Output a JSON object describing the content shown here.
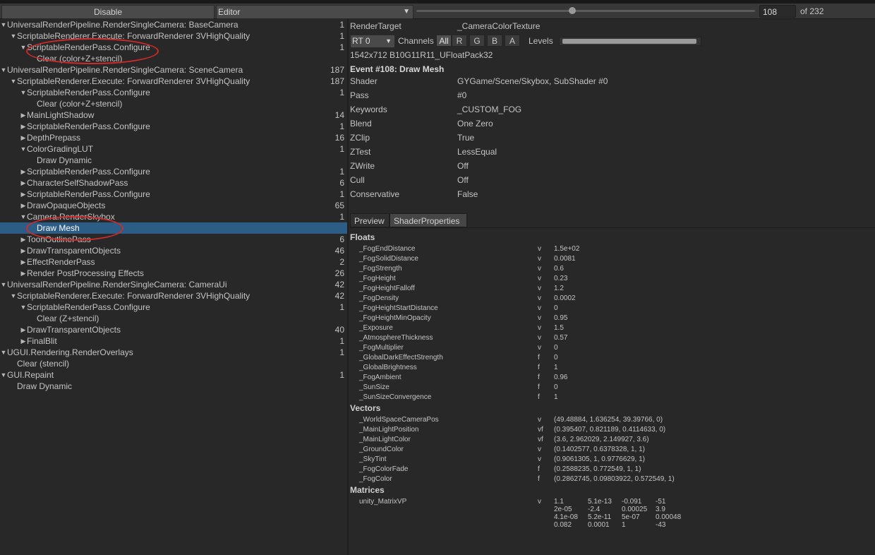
{
  "toolbar": {
    "disable_label": "Disable",
    "mode_value": "Editor",
    "event_number": "108",
    "event_total": "of 232",
    "slider_position": 0.46
  },
  "tree": [
    {
      "label": "UniversalRenderPipeline.RenderSingleCamera: BaseCamera",
      "count": "1",
      "depth": 0,
      "expander": "open"
    },
    {
      "label": "ScriptableRenderer.Execute: ForwardRenderer 3VHighQuality",
      "count": "1",
      "depth": 1,
      "expander": "open"
    },
    {
      "label": "ScriptableRenderPass.Configure",
      "count": "1",
      "depth": 2,
      "expander": "open"
    },
    {
      "label": "Clear (color+Z+stencil)",
      "count": "",
      "depth": 3,
      "expander": "none"
    },
    {
      "label": "UniversalRenderPipeline.RenderSingleCamera: SceneCamera",
      "count": "187",
      "depth": 0,
      "expander": "open"
    },
    {
      "label": "ScriptableRenderer.Execute: ForwardRenderer 3VHighQuality",
      "count": "187",
      "depth": 1,
      "expander": "open"
    },
    {
      "label": "ScriptableRenderPass.Configure",
      "count": "1",
      "depth": 2,
      "expander": "open"
    },
    {
      "label": "Clear (color+Z+stencil)",
      "count": "",
      "depth": 3,
      "expander": "none"
    },
    {
      "label": "MainLightShadow",
      "count": "14",
      "depth": 2,
      "expander": "closed"
    },
    {
      "label": "ScriptableRenderPass.Configure",
      "count": "1",
      "depth": 2,
      "expander": "closed"
    },
    {
      "label": "DepthPrepass",
      "count": "16",
      "depth": 2,
      "expander": "closed"
    },
    {
      "label": "ColorGradingLUT",
      "count": "1",
      "depth": 2,
      "expander": "open"
    },
    {
      "label": "Draw Dynamic",
      "count": "",
      "depth": 3,
      "expander": "none"
    },
    {
      "label": "ScriptableRenderPass.Configure",
      "count": "1",
      "depth": 2,
      "expander": "closed"
    },
    {
      "label": "CharacterSelfShadowPass",
      "count": "6",
      "depth": 2,
      "expander": "closed"
    },
    {
      "label": "ScriptableRenderPass.Configure",
      "count": "1",
      "depth": 2,
      "expander": "closed"
    },
    {
      "label": "DrawOpaqueObjects",
      "count": "65",
      "depth": 2,
      "expander": "closed"
    },
    {
      "label": "Camera.RenderSkybox",
      "count": "1",
      "depth": 2,
      "expander": "open"
    },
    {
      "label": "Draw Mesh",
      "count": "",
      "depth": 3,
      "expander": "none",
      "selected": true
    },
    {
      "label": "ToonOutlinePass",
      "count": "6",
      "depth": 2,
      "expander": "closed"
    },
    {
      "label": "DrawTransparentObjects",
      "count": "46",
      "depth": 2,
      "expander": "closed"
    },
    {
      "label": "EffectRenderPass",
      "count": "2",
      "depth": 2,
      "expander": "closed"
    },
    {
      "label": "Render PostProcessing Effects",
      "count": "26",
      "depth": 2,
      "expander": "closed"
    },
    {
      "label": "UniversalRenderPipeline.RenderSingleCamera: CameraUi",
      "count": "42",
      "depth": 0,
      "expander": "open"
    },
    {
      "label": "ScriptableRenderer.Execute: ForwardRenderer 3VHighQuality",
      "count": "42",
      "depth": 1,
      "expander": "open"
    },
    {
      "label": "ScriptableRenderPass.Configure",
      "count": "1",
      "depth": 2,
      "expander": "open"
    },
    {
      "label": "Clear (Z+stencil)",
      "count": "",
      "depth": 3,
      "expander": "none"
    },
    {
      "label": "DrawTransparentObjects",
      "count": "40",
      "depth": 2,
      "expander": "closed"
    },
    {
      "label": "FinalBlit",
      "count": "1",
      "depth": 2,
      "expander": "closed"
    },
    {
      "label": "UGUI.Rendering.RenderOverlays",
      "count": "1",
      "depth": 0,
      "expander": "open"
    },
    {
      "label": "Clear (stencil)",
      "count": "",
      "depth": 1,
      "expander": "none"
    },
    {
      "label": "GUI.Repaint",
      "count": "1",
      "depth": 0,
      "expander": "open"
    },
    {
      "label": "Draw Dynamic",
      "count": "",
      "depth": 1,
      "expander": "none"
    }
  ],
  "detail": {
    "render_target_label": "RenderTarget",
    "render_target_value": "_CameraColorTexture",
    "rt_select": "RT 0",
    "channels_label": "Channels",
    "channels": [
      "All",
      "R",
      "G",
      "B",
      "A"
    ],
    "levels_label": "Levels",
    "format": "1542x712 B10G11R11_UFloatPack32",
    "event_title": "Event #108: Draw Mesh",
    "props": [
      {
        "k": "Shader",
        "v": "GYGame/Scene/Skybox, SubShader #0"
      },
      {
        "k": "Pass",
        "v": "#0"
      },
      {
        "k": "Keywords",
        "v": "_CUSTOM_FOG"
      },
      {
        "k": "Blend",
        "v": "One Zero"
      },
      {
        "k": "ZClip",
        "v": "True"
      },
      {
        "k": "ZTest",
        "v": "LessEqual"
      },
      {
        "k": "ZWrite",
        "v": "Off"
      },
      {
        "k": "Cull",
        "v": "Off"
      },
      {
        "k": "Conservative",
        "v": "False"
      }
    ],
    "tabs": [
      "Preview",
      "ShaderProperties"
    ],
    "floats_title": "Floats",
    "floats": [
      {
        "n": "_FogEndDistance",
        "t": "v",
        "v": "1.5e+02"
      },
      {
        "n": "_FogSolidDistance",
        "t": "v",
        "v": "0.0081"
      },
      {
        "n": "_FogStrength",
        "t": "v",
        "v": "0.6"
      },
      {
        "n": "_FogHeight",
        "t": "v",
        "v": "0.23"
      },
      {
        "n": "_FogHeightFalloff",
        "t": "v",
        "v": "1.2"
      },
      {
        "n": "_FogDensity",
        "t": "v",
        "v": "0.0002"
      },
      {
        "n": "_FogHeightStartDistance",
        "t": "v",
        "v": "0"
      },
      {
        "n": "_FogHeightMinOpacity",
        "t": "v",
        "v": "0.95"
      },
      {
        "n": "_Exposure",
        "t": "v",
        "v": "1.5"
      },
      {
        "n": "_AtmosphereThickness",
        "t": "v",
        "v": "0.57"
      },
      {
        "n": "_FogMultiplier",
        "t": "v",
        "v": "0"
      },
      {
        "n": "_GlobalDarkEffectStrength",
        "t": "f",
        "v": "0"
      },
      {
        "n": "_GlobalBrightness",
        "t": "f",
        "v": "1"
      },
      {
        "n": "_FogAmbient",
        "t": "f",
        "v": "0.96"
      },
      {
        "n": "_SunSize",
        "t": "f",
        "v": "0"
      },
      {
        "n": "_SunSizeConvergence",
        "t": "f",
        "v": "1"
      }
    ],
    "vectors_title": "Vectors",
    "vectors": [
      {
        "n": "_WorldSpaceCameraPos",
        "t": "v",
        "v": "(49.48884, 1.636254, 39.39766, 0)"
      },
      {
        "n": "_MainLightPosition",
        "t": "vf",
        "v": "(0.395407, 0.821189, 0.4114633, 0)"
      },
      {
        "n": "_MainLightColor",
        "t": "vf",
        "v": "(3.6, 2.962029, 2.149927, 3.6)"
      },
      {
        "n": "_GroundColor",
        "t": "v",
        "v": "(0.1402577, 0.6378328, 1, 1)"
      },
      {
        "n": "_SkyTint",
        "t": "v",
        "v": "(0.9061305, 1, 0.9776629, 1)"
      },
      {
        "n": "_FogColorFade",
        "t": "f",
        "v": "(0.2588235, 0.772549, 1, 1)"
      },
      {
        "n": "_FogColor",
        "t": "f",
        "v": "(0.2862745, 0.09803922, 0.572549, 1)"
      }
    ],
    "matrices_title": "Matrices",
    "matrix_name": "unity_MatrixVP",
    "matrix_type": "v",
    "matrix": [
      [
        "1.1",
        "5.1e-13",
        "-0.091",
        "-51"
      ],
      [
        "2e-05",
        "-2.4",
        "0.00025",
        "3.9"
      ],
      [
        "4.1e-08",
        "5.2e-11",
        "5e-07",
        "0.00048"
      ],
      [
        "0.082",
        "0.0001",
        "1",
        "-43"
      ]
    ]
  },
  "colors": {
    "selection": "#2c5d87",
    "annotation_circle": "#d02a2a",
    "background": "#282828"
  }
}
